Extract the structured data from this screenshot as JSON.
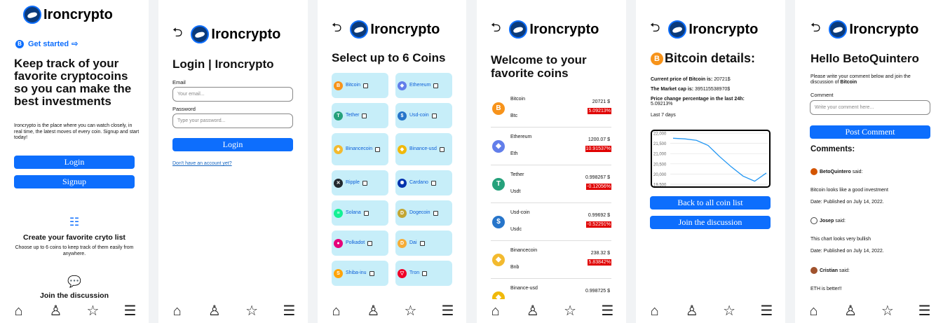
{
  "app": {
    "name": "Ironcrypto"
  },
  "welcome": {
    "get_started": "Get started",
    "hero": "Keep track of your favorite cryptocoins so you can make the best investments",
    "para": "Ironcrypto is the place where you can watch closely, in real time, the latest moves of every coin. Signup and start today!",
    "login_btn": "Login",
    "signup_btn": "Signup",
    "feature1_title": "Create your favorite cryto list",
    "feature1_text": "Choose up to 6 coins to keep track of them easily from anywhere.",
    "feature2_title": "Join the discussion"
  },
  "login": {
    "title": "Login | Ironcrypto",
    "email_label": "Email",
    "email_placeholder": "Your email...",
    "password_label": "Password",
    "password_placeholder": "Type your password...",
    "login_btn": "Login",
    "signup_link": "Don't have an account yet?"
  },
  "select": {
    "title": "Select up to 6 Coins",
    "coins": [
      {
        "name": "Bitcoin",
        "color": "#f7931a",
        "glyph": "B"
      },
      {
        "name": "Ethereum",
        "color": "#627eea",
        "glyph": "◆"
      },
      {
        "name": "Tether",
        "color": "#26a17b",
        "glyph": "T"
      },
      {
        "name": "Usd-coin",
        "color": "#2775ca",
        "glyph": "$"
      },
      {
        "name": "Binancecoin",
        "color": "#f3ba2f",
        "glyph": "◆"
      },
      {
        "name": "Binance-usd",
        "color": "#f0b90b",
        "glyph": "◆"
      },
      {
        "name": "Ripple",
        "color": "#23292f",
        "glyph": "✕"
      },
      {
        "name": "Cardano",
        "color": "#0033ad",
        "glyph": "✺"
      },
      {
        "name": "Solana",
        "color": "#14f195",
        "glyph": "≡"
      },
      {
        "name": "Dogecoin",
        "color": "#c2a633",
        "glyph": "D"
      },
      {
        "name": "Polkadot",
        "color": "#e6007a",
        "glyph": "●"
      },
      {
        "name": "Dai",
        "color": "#f5ac37",
        "glyph": "D"
      },
      {
        "name": "Shiba-inu",
        "color": "#ffa409",
        "glyph": "S"
      },
      {
        "name": "Tron",
        "color": "#ef0027",
        "glyph": "▽"
      }
    ]
  },
  "favorites": {
    "title": "Welcome to your favorite coins",
    "rows": [
      {
        "name": "Bitcoin",
        "symbol": "Btc",
        "price": "20721 $",
        "change": "5.09213%",
        "color": "#f7931a",
        "glyph": "B"
      },
      {
        "name": "Ethereum",
        "symbol": "Eth",
        "price": "1200.07 $",
        "change": "10.91537%",
        "color": "#627eea",
        "glyph": "◆"
      },
      {
        "name": "Tether",
        "symbol": "Usdt",
        "price": "0.998267 $",
        "change": "-0.12056%",
        "color": "#26a17b",
        "glyph": "T"
      },
      {
        "name": "Usd-coin",
        "symbol": "Usdc",
        "price": "0.99692 $",
        "change": "-0.52291%",
        "color": "#2775ca",
        "glyph": "$"
      },
      {
        "name": "Binancecoin",
        "symbol": "Bnb",
        "price": "238.32 $",
        "change": "5.83842%",
        "color": "#f3ba2f",
        "glyph": "◆"
      },
      {
        "name": "Binance-usd",
        "symbol": "",
        "price": "0.998725 $",
        "change": "",
        "color": "#f0b90b",
        "glyph": "◆"
      }
    ]
  },
  "details": {
    "title": "Bitcoin details:",
    "price_label": "Current price of Bitcoin is:",
    "price_value": "20721$",
    "cap_label": "The Market cap is:",
    "cap_value": "395115538970$",
    "change_label": "Price change percentage in the last 24h:",
    "change_value": "5.09213%",
    "period": "Last 7 days",
    "back_btn": "Back to all coin list",
    "join_btn": "Join the discussion"
  },
  "chart_data": {
    "type": "line",
    "title": "",
    "ylim": [
      19500,
      22000
    ],
    "yticks": [
      "22,000",
      "21,500",
      "21,000",
      "20,500",
      "20,000",
      "19,500"
    ],
    "series": [
      {
        "values": [
          21750,
          21720,
          21650,
          21400,
          20850,
          20350,
          19900,
          19650,
          20050
        ]
      }
    ]
  },
  "discussion": {
    "title": "Hello BetoQuintero",
    "intro_pre": "Please write your comment below and join the discussion of",
    "intro_coin": "Bitcoin",
    "comment_label": "Comment",
    "comment_placeholder": "Write your comment here...",
    "post_btn": "Post Comment",
    "comments_title": "Comments:",
    "said": "said:",
    "comments": [
      {
        "user": "BetoQuintero",
        "text": "Bitcoin looks like a good investment",
        "date": "Date: Published on July 14, 2022."
      },
      {
        "user": "Josep",
        "text": "This chart looks very bullish",
        "date": "Date: Published on July 14, 2022."
      },
      {
        "user": "Cristian",
        "text": "ETH is better!!",
        "date": ""
      }
    ]
  },
  "nav": {
    "home": "⌂",
    "profile": "♙",
    "favorites": "☆",
    "list": "☰",
    "back": "⮌"
  }
}
